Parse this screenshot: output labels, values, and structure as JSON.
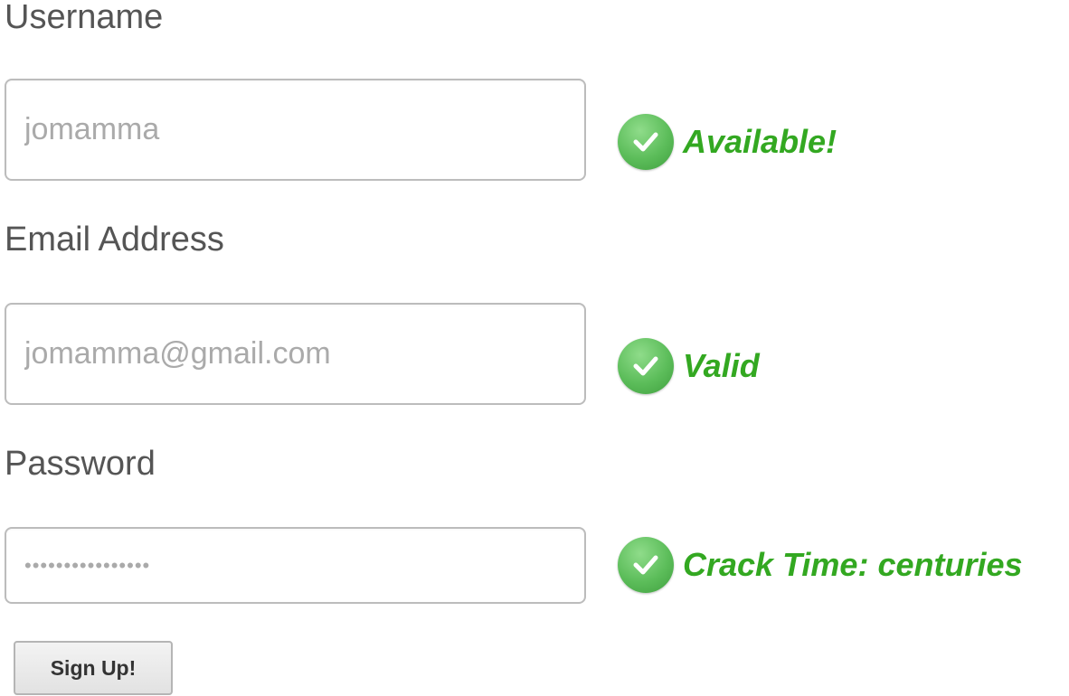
{
  "form": {
    "username": {
      "label": "Username",
      "placeholder": "jomamma",
      "status_icon": "check-circle-icon",
      "status_text": "Available!"
    },
    "email": {
      "label": "Email Address",
      "placeholder": "jomamma@gmail.com",
      "status_icon": "check-circle-icon",
      "status_text": "Valid"
    },
    "password": {
      "label": "Password",
      "value": "••••••••••••••••",
      "status_icon": "check-circle-icon",
      "status_text": "Crack Time: centuries"
    },
    "submit_label": "Sign Up!"
  },
  "colors": {
    "label_text": "#555555",
    "status_green": "#33a821",
    "field_border": "#bcbcbc",
    "placeholder": "#aaaaaa"
  }
}
